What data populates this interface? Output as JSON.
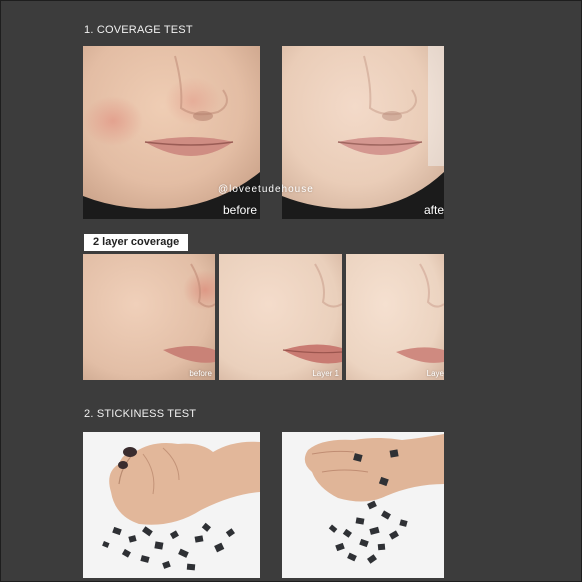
{
  "sections": {
    "coverage_title": "1. COVERAGE TEST",
    "stickiness_title": "2. STICKINESS TEST"
  },
  "coverage_photos": [
    {
      "caption": "before"
    },
    {
      "caption": "afte"
    }
  ],
  "watermark": "@loveetudehouse",
  "layer_badge": "2 layer coverage",
  "layer_photos": [
    {
      "caption": "before"
    },
    {
      "caption": "Layer 1"
    },
    {
      "caption": "Laye"
    }
  ],
  "colors": {
    "background": "#3c3c3c",
    "skin": "#e7c2a9",
    "lips": "#cf8d83",
    "shirt": "#1b1b1b"
  }
}
